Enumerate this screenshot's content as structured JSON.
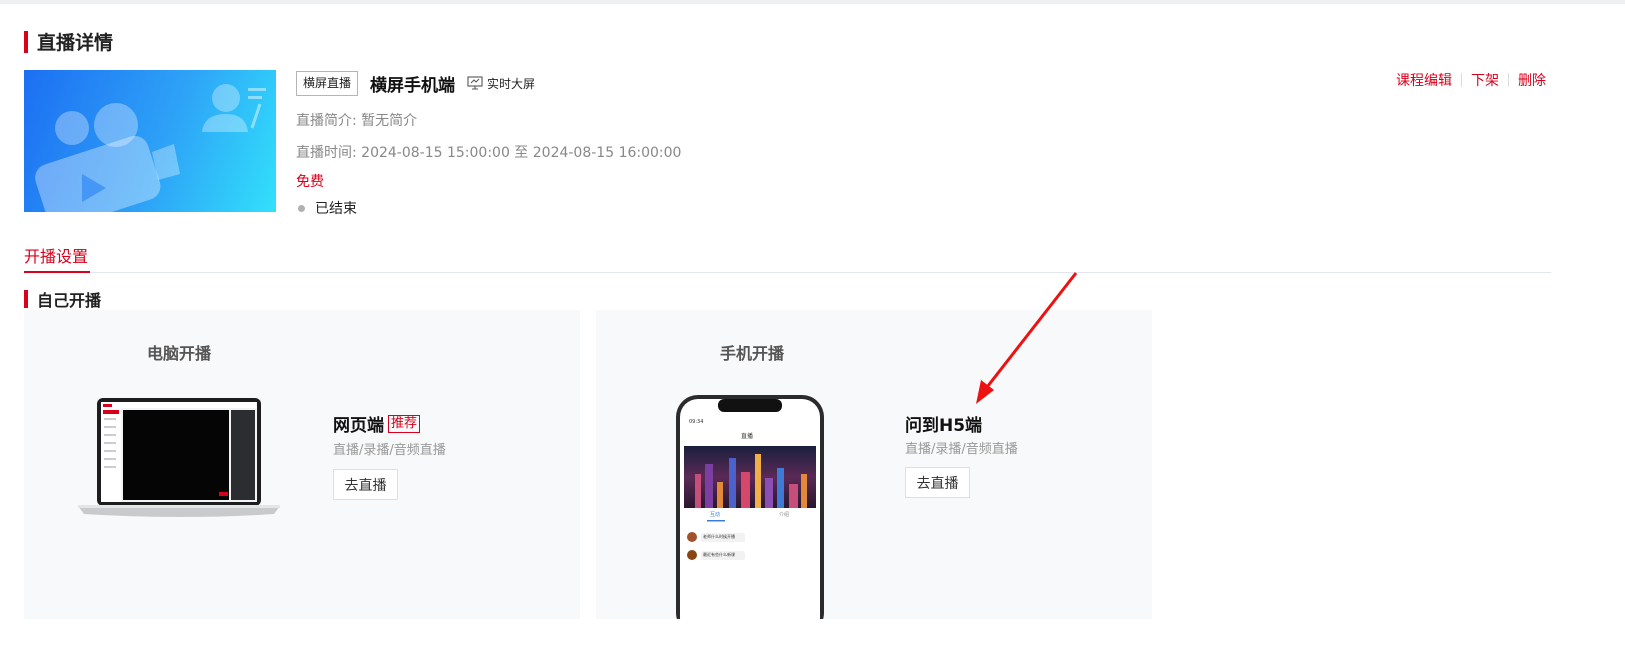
{
  "section_title": "直播详情",
  "live": {
    "badge": "横屏直播",
    "title": "横屏手机端",
    "screen_link": "实时大屏",
    "intro": "直播简介: 暂无简介",
    "time": "直播时间:  2024-08-15 15:00:00 至 2024-08-15 16:00:00",
    "price": "免费",
    "status": "已结束"
  },
  "ops": {
    "edit": "课程编辑",
    "offline": "下架",
    "delete": "删除"
  },
  "tabs": {
    "active": "开播设置"
  },
  "self_section_title": "自己开播",
  "pc_card": {
    "title": "电脑开播",
    "option_title": "网页端",
    "recommend": "推荐",
    "desc": "直播/录播/音频直播",
    "button": "去直播"
  },
  "mobile_card": {
    "title": "手机开播",
    "option_title": "问到H5端",
    "desc": "直播/录播/音频直播",
    "button": "去直播",
    "phone_screen": {
      "time": "09:34",
      "header": "直播",
      "tab_chat": "互动",
      "tab_intro": "介绍",
      "msg1": "老师什么时候开播",
      "msg2": "最近有些什么新课"
    }
  },
  "colors": {
    "accent": "#d9001b",
    "card_bg": "#f8f9fa"
  }
}
